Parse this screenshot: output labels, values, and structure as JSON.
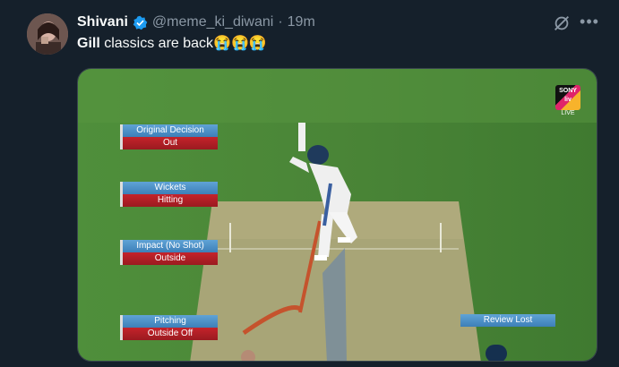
{
  "tweet": {
    "author_name": "Shivani",
    "handle": "@meme_ki_diwani",
    "separator": "·",
    "time": "19m",
    "text_bold": "Gill",
    "text_rest": " classics are back😭😭😭"
  },
  "overlay": {
    "panels": [
      {
        "title": "Original Decision",
        "value": "Out"
      },
      {
        "title": "Wickets",
        "value": "Hitting"
      },
      {
        "title": "Impact (No Shot)",
        "value": "Outside"
      },
      {
        "title": "Pitching",
        "value": "Outside Off"
      }
    ],
    "review_status": "Review Lost",
    "broadcaster_top": "SONY",
    "broadcaster_mid": "liv",
    "broadcaster_label": "LIVE"
  },
  "colors": {
    "background": "#15202b",
    "verified": "#1d9bf0",
    "pitch_green": "#4e8a3a",
    "panel_blue": "#4a8fc7",
    "panel_red": "#b51f26"
  },
  "icons": [
    "avatar",
    "verified-badge-icon",
    "grok-icon",
    "more-options-icon"
  ]
}
